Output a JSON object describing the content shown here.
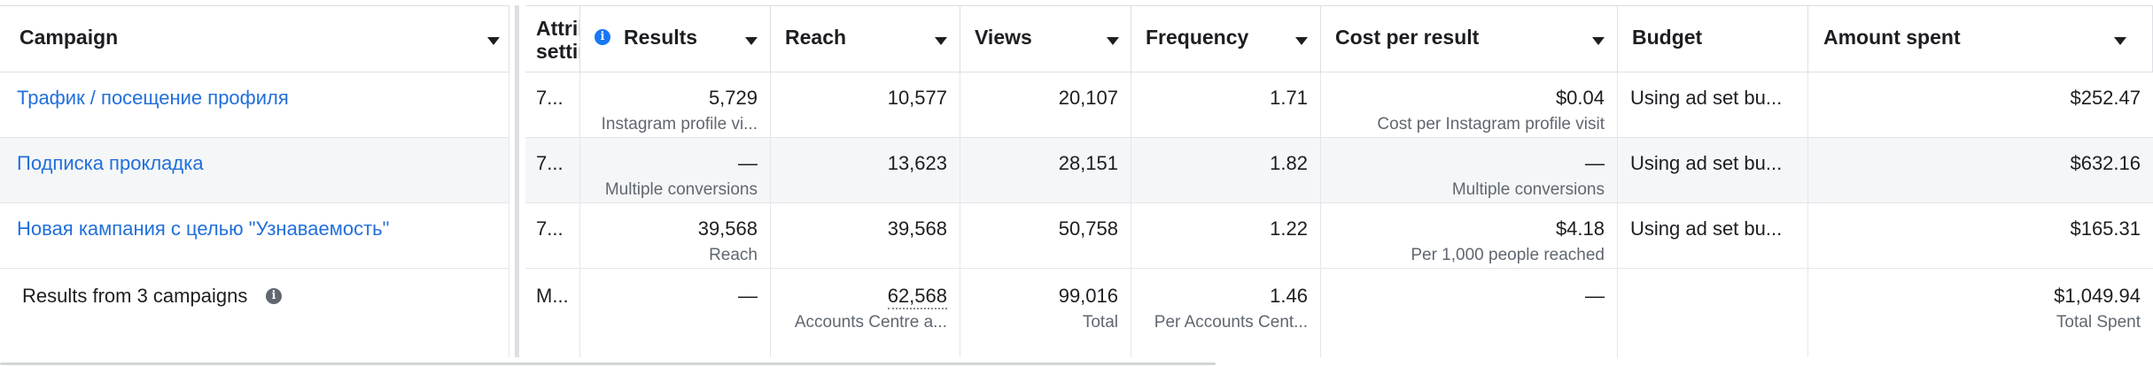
{
  "header": {
    "campaign": "Campaign",
    "attribution": "Attribution setting",
    "results": "Results",
    "reach": "Reach",
    "views": "Views",
    "frequency": "Frequency",
    "cost_per_result": "Cost per result",
    "budget": "Budget",
    "amount_spent": "Amount spent"
  },
  "rows": [
    {
      "name": "Трафик / посещение профиля",
      "attribution": "7...",
      "results": "5,729",
      "results_sub": "Instagram profile vi...",
      "reach": "10,577",
      "views": "20,107",
      "frequency": "1.71",
      "cost": "$0.04",
      "cost_sub": "Cost per Instagram profile visit",
      "budget": "Using ad set bu...",
      "spent": "$252.47"
    },
    {
      "name": "Подписка прокладка",
      "attribution": "7...",
      "results": "—",
      "results_sub": "Multiple conversions",
      "reach": "13,623",
      "views": "28,151",
      "frequency": "1.82",
      "cost": "—",
      "cost_sub": "Multiple conversions",
      "budget": "Using ad set bu...",
      "spent": "$632.16"
    },
    {
      "name": "Новая кампания с целью \"Узнаваемость\"",
      "attribution": "7...",
      "results": "39,568",
      "results_sub": "Reach",
      "reach": "39,568",
      "views": "50,758",
      "frequency": "1.22",
      "cost": "$4.18",
      "cost_sub": "Per 1,000 people reached",
      "budget": "Using ad set bu...",
      "spent": "$165.31"
    }
  ],
  "summary": {
    "label": "Results from 3 campaigns",
    "attribution": "M...",
    "results": "—",
    "reach": "62,568",
    "reach_sub": "Accounts Centre a...",
    "views": "99,016",
    "views_sub": "Total",
    "frequency": "1.46",
    "frequency_sub": "Per Accounts Cent...",
    "cost": "—",
    "spent": "$1,049.94",
    "spent_sub": "Total Spent"
  },
  "icons": {
    "info": "info-icon",
    "sort": "chevron-down-icon"
  },
  "colors": {
    "link": "#216fdb",
    "info_blue": "#1877f2",
    "row_alt": "#f5f6f7"
  }
}
